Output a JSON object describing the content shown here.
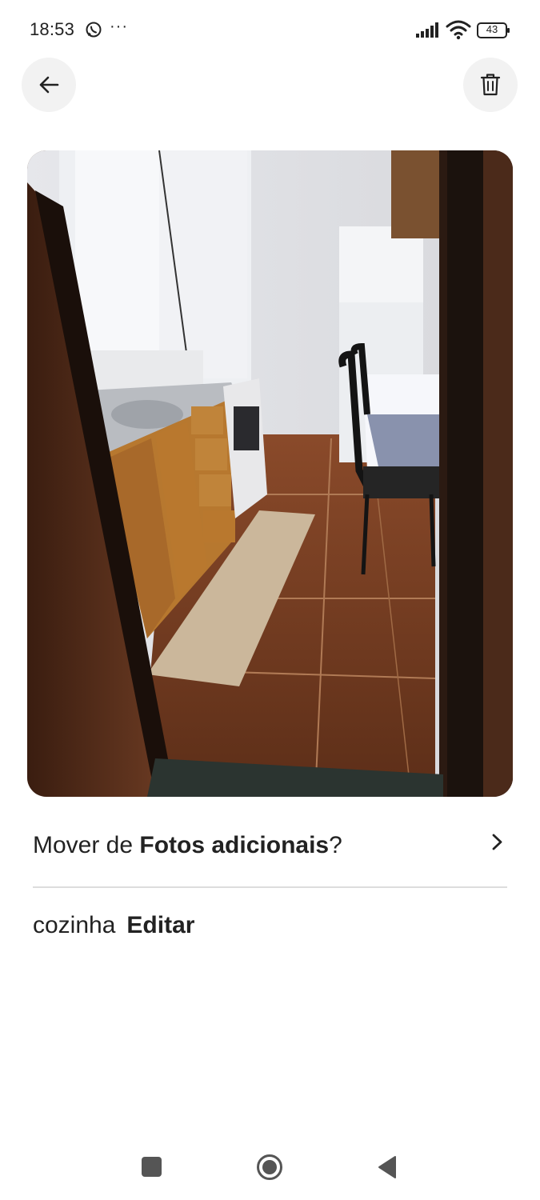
{
  "status_bar": {
    "time": "18:53",
    "more": "···",
    "battery": "43"
  },
  "header": {
    "back_icon": "arrow-left-icon",
    "delete_icon": "trash-icon"
  },
  "photo": {
    "subject": "kitchen photo"
  },
  "move_row": {
    "prefix": "Mover de ",
    "album": "Fotos adicionais",
    "suffix": "?"
  },
  "caption": {
    "label": "cozinha",
    "edit": "Editar"
  },
  "nav": {
    "icons": [
      "recents-icon",
      "home-icon",
      "back-triangle-icon"
    ]
  },
  "colors": {
    "text": "#222222",
    "button_bg": "#f2f2f2",
    "divider": "#dddddd"
  }
}
